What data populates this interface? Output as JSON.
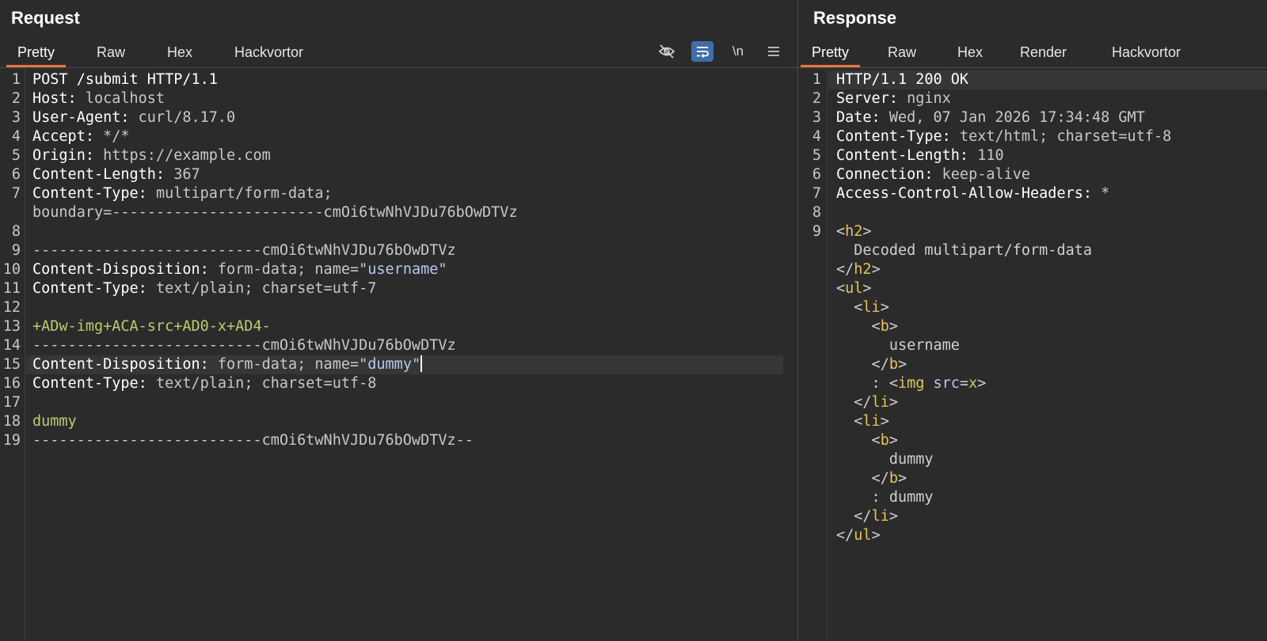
{
  "request": {
    "title": "Request",
    "tabs": [
      "Pretty",
      "Raw",
      "Hex",
      "Hackvortor"
    ],
    "active_tab": "Pretty",
    "tools": {
      "newline_label": "\\n"
    },
    "lines": [
      {
        "n": "1",
        "parts": [
          [
            "k",
            "POST /submit HTTP/1.1"
          ]
        ]
      },
      {
        "n": "2",
        "parts": [
          [
            "k",
            "Host: "
          ],
          [
            "v",
            "localhost"
          ]
        ]
      },
      {
        "n": "3",
        "parts": [
          [
            "k",
            "User-Agent: "
          ],
          [
            "v",
            "curl/8.17.0"
          ]
        ]
      },
      {
        "n": "4",
        "parts": [
          [
            "k",
            "Accept: "
          ],
          [
            "v",
            "*/*"
          ]
        ]
      },
      {
        "n": "5",
        "parts": [
          [
            "k",
            "Origin: "
          ],
          [
            "v",
            "https://example.com"
          ]
        ]
      },
      {
        "n": "6",
        "parts": [
          [
            "k",
            "Content-Length: "
          ],
          [
            "v",
            "367"
          ]
        ]
      },
      {
        "n": "7",
        "parts": [
          [
            "k",
            "Content-Type: "
          ],
          [
            "v",
            "multipart/form-data;"
          ]
        ]
      },
      {
        "n": "",
        "parts": [
          [
            "v",
            "boundary=------------------------cmOi6twNhVJDu76bOwDTVz"
          ]
        ]
      },
      {
        "n": "8",
        "parts": []
      },
      {
        "n": "9",
        "parts": [
          [
            "v",
            "--------------------------cmOi6twNhVJDu76bOwDTVz"
          ]
        ]
      },
      {
        "n": "10",
        "parts": [
          [
            "k",
            "Content-Disposition: "
          ],
          [
            "v",
            "form-data; name=\""
          ],
          [
            "s",
            "username"
          ],
          [
            "v",
            "\""
          ]
        ]
      },
      {
        "n": "11",
        "parts": [
          [
            "k",
            "Content-Type: "
          ],
          [
            "v",
            "text/plain; charset=utf-7"
          ]
        ]
      },
      {
        "n": "12",
        "parts": []
      },
      {
        "n": "13",
        "parts": [
          [
            "g",
            "+ADw-img+ACA-src+AD0-x+AD4-"
          ]
        ]
      },
      {
        "n": "14",
        "parts": [
          [
            "v",
            "--------------------------cmOi6twNhVJDu76bOwDTVz"
          ]
        ]
      },
      {
        "n": "15",
        "hl": true,
        "caret": true,
        "parts": [
          [
            "k",
            "Content-Disposition: "
          ],
          [
            "v",
            "form-data; name=\""
          ],
          [
            "s",
            "dummy"
          ],
          [
            "v",
            "\""
          ]
        ]
      },
      {
        "n": "16",
        "parts": [
          [
            "k",
            "Content-Type: "
          ],
          [
            "v",
            "text/plain; charset=utf-8"
          ]
        ]
      },
      {
        "n": "17",
        "parts": []
      },
      {
        "n": "18",
        "parts": [
          [
            "g",
            "dummy"
          ]
        ]
      },
      {
        "n": "19",
        "parts": [
          [
            "v",
            "--------------------------cmOi6twNhVJDu76bOwDTVz--"
          ]
        ]
      }
    ]
  },
  "response": {
    "title": "Response",
    "tabs": [
      "Pretty",
      "Raw",
      "Hex",
      "Render",
      "Hackvortor"
    ],
    "active_tab": "Pretty",
    "lines": [
      {
        "n": "1",
        "hl": true,
        "parts": [
          [
            "k",
            "HTTP/1.1 200 OK"
          ]
        ]
      },
      {
        "n": "2",
        "parts": [
          [
            "k",
            "Server: "
          ],
          [
            "v",
            "nginx"
          ]
        ]
      },
      {
        "n": "3",
        "parts": [
          [
            "k",
            "Date: "
          ],
          [
            "v",
            "Wed, 07 Jan 2026 17:34:48 GMT"
          ]
        ]
      },
      {
        "n": "4",
        "parts": [
          [
            "k",
            "Content-Type: "
          ],
          [
            "v",
            "text/html; charset=utf-8"
          ]
        ]
      },
      {
        "n": "5",
        "parts": [
          [
            "k",
            "Content-Length: "
          ],
          [
            "v",
            "110"
          ]
        ]
      },
      {
        "n": "6",
        "parts": [
          [
            "k",
            "Connection: "
          ],
          [
            "v",
            "keep-alive"
          ]
        ]
      },
      {
        "n": "7",
        "parts": [
          [
            "k",
            "Access-Control-Allow-Headers: "
          ],
          [
            "v",
            "*"
          ]
        ]
      },
      {
        "n": "8",
        "parts": []
      },
      {
        "n": "9",
        "parts": [
          [
            "p",
            "<"
          ],
          [
            "t",
            "h2"
          ],
          [
            "p",
            ">"
          ]
        ]
      },
      {
        "n": "",
        "parts": [
          [
            "p",
            "  Decoded multipart/form-data"
          ]
        ]
      },
      {
        "n": "",
        "parts": [
          [
            "p",
            "</"
          ],
          [
            "t",
            "h2"
          ],
          [
            "p",
            ">"
          ]
        ]
      },
      {
        "n": "",
        "parts": [
          [
            "p",
            "<"
          ],
          [
            "t",
            "ul"
          ],
          [
            "p",
            ">"
          ]
        ]
      },
      {
        "n": "",
        "parts": [
          [
            "p",
            "  <"
          ],
          [
            "t",
            "li"
          ],
          [
            "p",
            ">"
          ]
        ]
      },
      {
        "n": "",
        "parts": [
          [
            "p",
            "    <"
          ],
          [
            "t",
            "b"
          ],
          [
            "p",
            ">"
          ]
        ]
      },
      {
        "n": "",
        "parts": [
          [
            "p",
            "      username"
          ]
        ]
      },
      {
        "n": "",
        "parts": [
          [
            "p",
            "    </"
          ],
          [
            "t",
            "b"
          ],
          [
            "p",
            ">"
          ]
        ]
      },
      {
        "n": "",
        "parts": [
          [
            "p",
            "    : <"
          ],
          [
            "t",
            "img "
          ],
          [
            "a",
            "src"
          ],
          [
            "p",
            "="
          ],
          [
            "g",
            "x"
          ],
          [
            "p",
            ">"
          ]
        ]
      },
      {
        "n": "",
        "parts": [
          [
            "p",
            "  </"
          ],
          [
            "t",
            "li"
          ],
          [
            "p",
            ">"
          ]
        ]
      },
      {
        "n": "",
        "parts": [
          [
            "p",
            "  <"
          ],
          [
            "t",
            "li"
          ],
          [
            "p",
            ">"
          ]
        ]
      },
      {
        "n": "",
        "parts": [
          [
            "p",
            "    <"
          ],
          [
            "t",
            "b"
          ],
          [
            "p",
            ">"
          ]
        ]
      },
      {
        "n": "",
        "parts": [
          [
            "p",
            "      dummy"
          ]
        ]
      },
      {
        "n": "",
        "parts": [
          [
            "p",
            "    </"
          ],
          [
            "t",
            "b"
          ],
          [
            "p",
            ">"
          ]
        ]
      },
      {
        "n": "",
        "parts": [
          [
            "p",
            "    : dummy"
          ]
        ]
      },
      {
        "n": "",
        "parts": [
          [
            "p",
            "  </"
          ],
          [
            "t",
            "li"
          ],
          [
            "p",
            ">"
          ]
        ]
      },
      {
        "n": "",
        "parts": [
          [
            "p",
            "</"
          ],
          [
            "t",
            "ul"
          ],
          [
            "p",
            ">"
          ]
        ]
      }
    ]
  },
  "colors": {
    "background": "#2b2b2b",
    "accent_tab_underline": "#e8753a",
    "active_tool": "#3f6ea8",
    "tag": "#e8c35a",
    "string": "#b7c8f3",
    "body_text": "#b9cd6f"
  },
  "icons": [
    "hide-icon",
    "wrap-lines-icon",
    "newline-icon",
    "menu-icon"
  ]
}
